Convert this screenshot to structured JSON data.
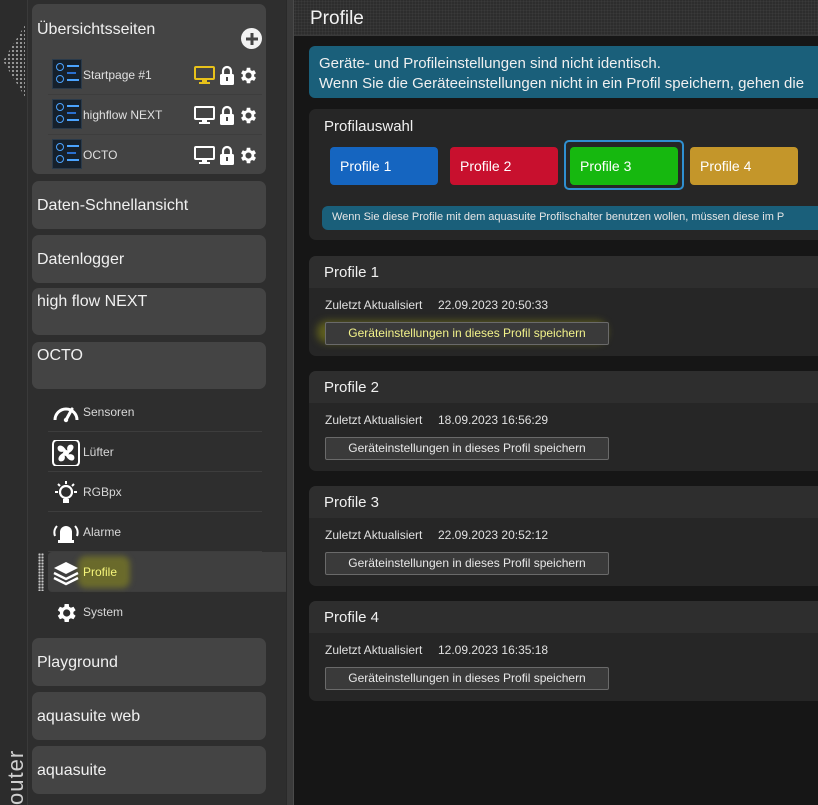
{
  "left_strip": {
    "label": "outer"
  },
  "sidebar": {
    "overview": {
      "title": "Übersichtsseiten",
      "pages": [
        {
          "label": "Startpage #1",
          "monitor_color": "#e8c21a"
        },
        {
          "label": "highflow NEXT",
          "monitor_color": "#ffffff"
        },
        {
          "label": "OCTO",
          "monitor_color": "#ffffff"
        }
      ]
    },
    "quickview": {
      "title": "Daten-Schnellansicht"
    },
    "datalogger": {
      "title": "Datenlogger"
    },
    "highflow": {
      "title": "high flow NEXT"
    },
    "octo": {
      "title": "OCTO",
      "items": [
        {
          "label": "Sensoren",
          "icon": "gauge-icon"
        },
        {
          "label": "Lüfter",
          "icon": "fan-icon"
        },
        {
          "label": "RGBpx",
          "icon": "bulb-icon"
        },
        {
          "label": "Alarme",
          "icon": "alarm-icon"
        },
        {
          "label": "Profile",
          "icon": "layers-icon",
          "active": true
        },
        {
          "label": "System",
          "icon": "gear-icon"
        }
      ]
    },
    "playground": {
      "title": "Playground"
    },
    "aquasuite_web": {
      "title": "aquasuite web"
    },
    "aquasuite": {
      "title": "aquasuite"
    }
  },
  "main": {
    "title": "Profile",
    "banner": {
      "line1": "Geräte- und Profileinstellungen sind nicht identisch.",
      "line2": "Wenn Sie die Geräteeinstellungen nicht in ein Profil speichern, gehen die"
    },
    "profile_select": {
      "title": "Profilauswahl",
      "buttons": [
        {
          "label": "Profile 1",
          "color": "#1565c0"
        },
        {
          "label": "Profile 2",
          "color": "#c8102e"
        },
        {
          "label": "Profile 3",
          "color": "#16b80f",
          "selected": true
        },
        {
          "label": "Profile 4",
          "color": "#c4962a"
        }
      ],
      "hint": "Wenn Sie diese Profile mit dem aquasuite Profilschalter benutzen wollen, müssen diese im P"
    },
    "profiles": [
      {
        "title": "Profile 1",
        "updated_label": "Zuletzt Aktualisiert",
        "updated_value": "22.09.2023 20:50:33",
        "save_label": "Geräteinstellungen in dieses Profil speichern",
        "highlighted": true
      },
      {
        "title": "Profile 2",
        "updated_label": "Zuletzt Aktualisiert",
        "updated_value": "18.09.2023 16:56:29",
        "save_label": "Geräteinstellungen in dieses Profil speichern"
      },
      {
        "title": "Profile 3",
        "updated_label": "Zuletzt Aktualisiert",
        "updated_value": "22.09.2023 20:52:12",
        "save_label": "Geräteinstellungen in dieses Profil speichern"
      },
      {
        "title": "Profile 4",
        "updated_label": "Zuletzt Aktualisiert",
        "updated_value": "12.09.2023 16:35:18",
        "save_label": "Geräteinstellungen in dieses Profil speichern"
      }
    ]
  }
}
